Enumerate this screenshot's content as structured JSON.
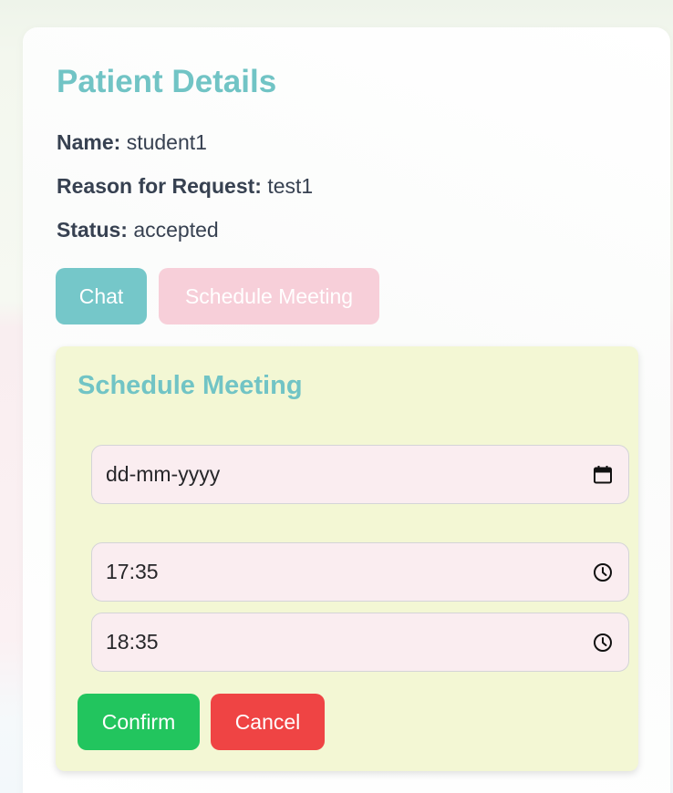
{
  "details": {
    "title": "Patient Details",
    "name_label": "Name:",
    "name_value": "student1",
    "reason_label": "Reason for Request:",
    "reason_value": "test1",
    "status_label": "Status:",
    "status_value": "accepted"
  },
  "actions": {
    "chat_label": "Chat",
    "schedule_label": "Schedule Meeting"
  },
  "schedule": {
    "title": "Schedule Meeting",
    "date_placeholder": "dd-mm-yyyy",
    "start_time": "17:35",
    "end_time": "18:35",
    "confirm_label": "Confirm",
    "cancel_label": "Cancel"
  },
  "icons": {
    "date": "calendar-icon",
    "time": "clock-icon"
  },
  "colors": {
    "accent_teal": "#71c4c5",
    "chat_button": "#75c7c9",
    "schedule_button": "#f7cfd9",
    "panel_bg": "#f3f7d4",
    "input_bg": "#faedf0",
    "confirm": "#22c55e",
    "cancel": "#ef4444"
  }
}
